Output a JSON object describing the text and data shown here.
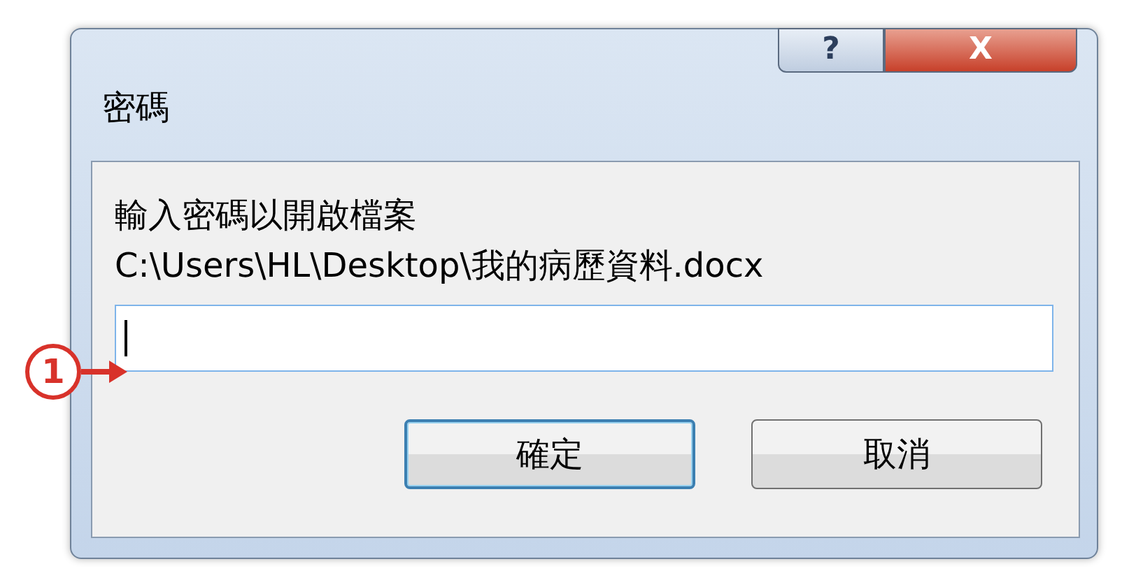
{
  "window": {
    "title": "密碼"
  },
  "title_buttons": [
    {
      "kind": "help",
      "label": "?"
    },
    {
      "kind": "close",
      "label": "X"
    }
  ],
  "prompt": "輸入密碼以開啟檔案",
  "file_path": "C:\\Users\\HL\\Desktop\\我的病歷資料.docx",
  "password_field": {
    "focused": true
  },
  "callout": {
    "label": "1"
  },
  "buttons": [
    {
      "label": "確定",
      "default": true
    },
    {
      "label": "取消",
      "default": false
    }
  ]
}
